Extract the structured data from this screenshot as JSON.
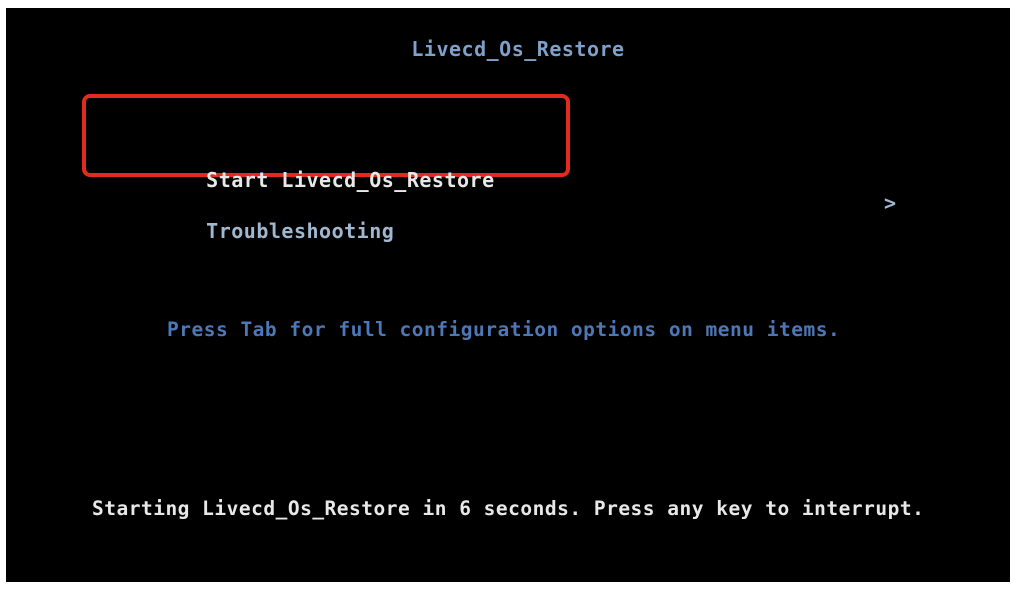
{
  "header": {
    "title": "Livecd_Os_Restore"
  },
  "menu": {
    "items": [
      {
        "label": "Start Livecd_Os_Restore",
        "selected": true,
        "has_submenu": false
      },
      {
        "label": "Troubleshooting",
        "selected": false,
        "has_submenu": true,
        "submenu_glyph": ">"
      }
    ]
  },
  "hint": "Press Tab for full configuration options on menu items.",
  "footer": {
    "countdown": "Starting Livecd_Os_Restore in 6 seconds. Press any key to interrupt."
  },
  "colors": {
    "background": "#000000",
    "title": "#7fa0c8",
    "selected_text": "#e8e8e8",
    "menu_text": "#9fb7cf",
    "hint_text": "#4d78b8",
    "highlight_box": "#e12b1f"
  }
}
